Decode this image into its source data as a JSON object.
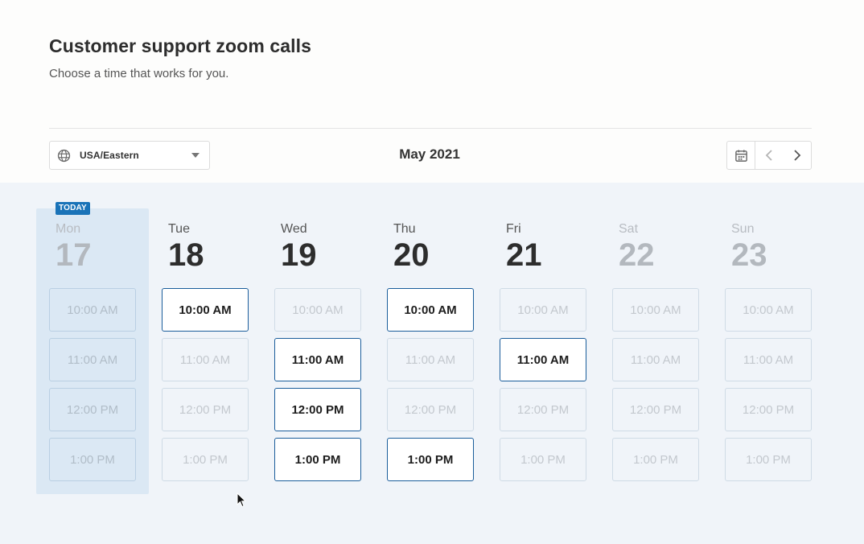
{
  "page": {
    "title": "Customer support zoom calls",
    "subtitle": "Choose a time that works for you."
  },
  "toolbar": {
    "timezone": "USA/Eastern",
    "month": "May 2021"
  },
  "today_badge": "TODAY",
  "colors": {
    "accent": "#1a73b8",
    "available_border": "#1a5d9b",
    "calendar_bg": "#f0f4f9",
    "today_bg": "#dbe8f4"
  },
  "days": [
    {
      "name": "Mon",
      "num": "17",
      "dim": true,
      "today": true,
      "slots": [
        {
          "label": "10:00 AM",
          "available": false
        },
        {
          "label": "11:00 AM",
          "available": false
        },
        {
          "label": "12:00 PM",
          "available": false
        },
        {
          "label": "1:00 PM",
          "available": false
        }
      ]
    },
    {
      "name": "Tue",
      "num": "18",
      "dim": false,
      "today": false,
      "slots": [
        {
          "label": "10:00 AM",
          "available": true
        },
        {
          "label": "11:00 AM",
          "available": false
        },
        {
          "label": "12:00 PM",
          "available": false
        },
        {
          "label": "1:00 PM",
          "available": false
        }
      ]
    },
    {
      "name": "Wed",
      "num": "19",
      "dim": false,
      "today": false,
      "slots": [
        {
          "label": "10:00 AM",
          "available": false
        },
        {
          "label": "11:00 AM",
          "available": true
        },
        {
          "label": "12:00 PM",
          "available": true
        },
        {
          "label": "1:00 PM",
          "available": true
        }
      ]
    },
    {
      "name": "Thu",
      "num": "20",
      "dim": false,
      "today": false,
      "slots": [
        {
          "label": "10:00 AM",
          "available": true
        },
        {
          "label": "11:00 AM",
          "available": false
        },
        {
          "label": "12:00 PM",
          "available": false
        },
        {
          "label": "1:00 PM",
          "available": true
        }
      ]
    },
    {
      "name": "Fri",
      "num": "21",
      "dim": false,
      "today": false,
      "slots": [
        {
          "label": "10:00 AM",
          "available": false
        },
        {
          "label": "11:00 AM",
          "available": true
        },
        {
          "label": "12:00 PM",
          "available": false
        },
        {
          "label": "1:00 PM",
          "available": false
        }
      ]
    },
    {
      "name": "Sat",
      "num": "22",
      "dim": true,
      "today": false,
      "slots": [
        {
          "label": "10:00 AM",
          "available": false
        },
        {
          "label": "11:00 AM",
          "available": false
        },
        {
          "label": "12:00 PM",
          "available": false
        },
        {
          "label": "1:00 PM",
          "available": false
        }
      ]
    },
    {
      "name": "Sun",
      "num": "23",
      "dim": true,
      "today": false,
      "slots": [
        {
          "label": "10:00 AM",
          "available": false
        },
        {
          "label": "11:00 AM",
          "available": false
        },
        {
          "label": "12:00 PM",
          "available": false
        },
        {
          "label": "1:00 PM",
          "available": false
        }
      ]
    }
  ]
}
